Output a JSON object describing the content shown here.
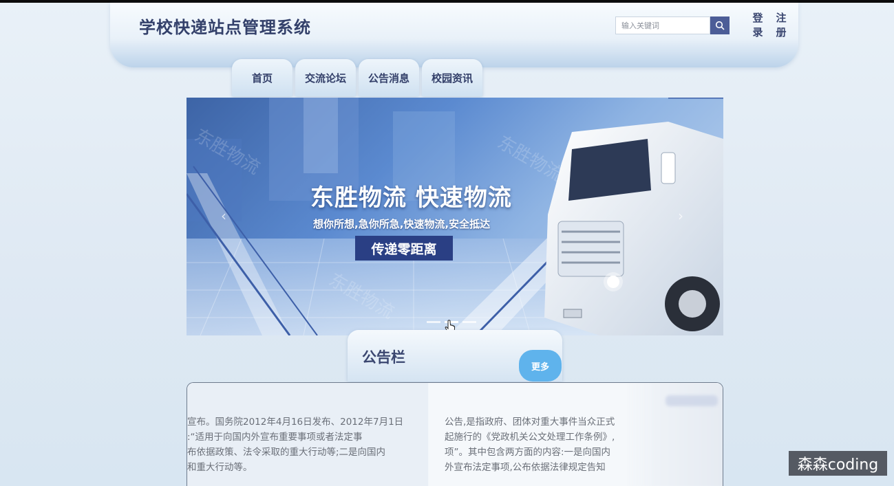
{
  "header": {
    "title": "学校快递站点管理系统",
    "search": {
      "placeholder": "输入关键词",
      "icon": "search-icon"
    },
    "login_label": "登录",
    "login_chars": [
      "登",
      "录"
    ],
    "register_label": "注册",
    "register_chars": [
      "注",
      "册"
    ]
  },
  "nav": {
    "tabs": [
      {
        "label": "首页"
      },
      {
        "label": "交流论坛"
      },
      {
        "label": "公告消息"
      },
      {
        "label": "校园资讯"
      }
    ]
  },
  "banner": {
    "headline": "东胜物流 快速物流",
    "subline": "想你所想,急你所急,快速物流,安全抵达",
    "cta": "传递零距离",
    "watermark_text": "东胜物流",
    "slides_total": 3,
    "active_slide": 2
  },
  "notices": {
    "title": "公告栏",
    "more_label": "更多",
    "cards": [
      {
        "lines": [
          "宣布。国务院2012年4月16日发布、2012年7月1日",
          ":“适用于向国内外宣布重要事项或者法定事",
          "布依据政策、法令采取的重大行动等;二是向国内",
          "和重大行动等。"
        ]
      },
      {
        "lines": [
          "公告,是指政府、团体对重大事件当众正式",
          "起施行的《党政机关公文处理工作条例》,",
          "项”。其中包含两方面的内容:一是向国内",
          "外宣布法定事项,公布依据法律规定告知"
        ]
      }
    ]
  },
  "overlay": {
    "watermark": "森森coding"
  },
  "colors": {
    "accent": "#4c5d97",
    "more_button": "#5fb3ec",
    "cta": "#2a3f84",
    "title_text": "#33406a"
  }
}
